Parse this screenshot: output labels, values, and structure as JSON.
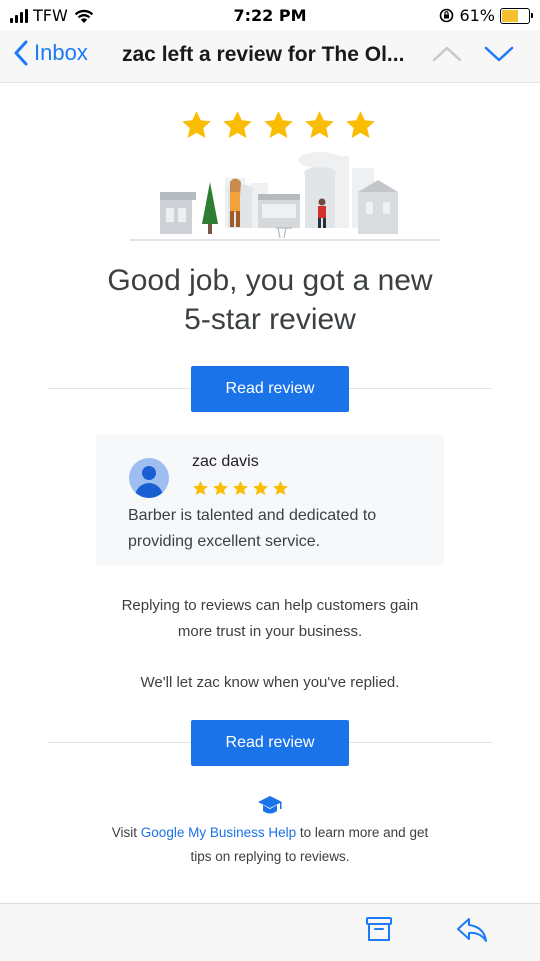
{
  "status_bar": {
    "carrier": "TFW",
    "time": "7:22 PM",
    "battery_percent": "61%",
    "battery_level": 0.61,
    "battery_color": "#f6c02c"
  },
  "nav": {
    "back_label": "Inbox",
    "title": "zac left a review for The Ol...",
    "accent_color": "#1d7bf6"
  },
  "email": {
    "rating_stars": 5,
    "star_color": "#fbbc04",
    "headline_line1": "Good job, you got a new",
    "headline_line2": "5-star review",
    "read_review_label_1": "Read review",
    "review": {
      "reviewer_name": "zac davis",
      "stars": 5,
      "text_line1": "Barber is talented and dedicated to",
      "text_line2": "providing excellent service."
    },
    "reply_tip_line1": "Replying to reviews can help customers gain",
    "reply_tip_line2": "more trust in your business.",
    "notify_text": "We'll let zac know when you've replied.",
    "read_review_label_2": "Read review",
    "help": {
      "prefix": "Visit ",
      "link": "Google My Business Help",
      "suffix": " to learn more and get",
      "line2": "tips on replying to reviews."
    },
    "button_color": "#1a73e8"
  },
  "toolbar": {
    "icons": [
      "archive-icon",
      "reply-icon"
    ]
  }
}
